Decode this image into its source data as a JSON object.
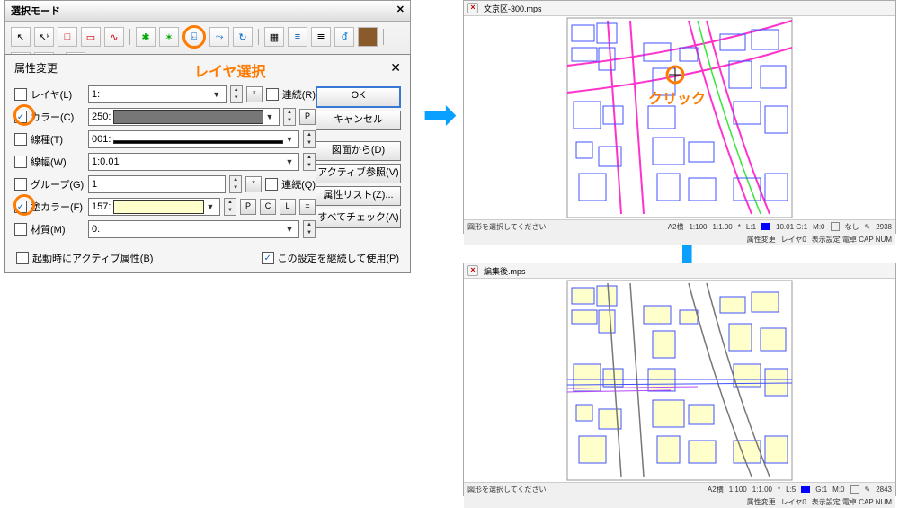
{
  "toolbar": {
    "title": "選択モード",
    "close": "✕"
  },
  "annotations": {
    "layer_select": "レイヤ選択",
    "click": "クリック"
  },
  "dialog": {
    "title": "属性変更",
    "close": "✕",
    "rows": {
      "layer": {
        "label": "レイヤ(L)",
        "value": "1:",
        "checked": false
      },
      "color": {
        "label": "カラー(C)",
        "value": "250:",
        "checked": true
      },
      "linetype": {
        "label": "線種(T)",
        "value": "001:",
        "checked": false
      },
      "linewid": {
        "label": "線幅(W)",
        "value": "1:0.01",
        "checked": false
      },
      "group": {
        "label": "グループ(G)",
        "value": "1",
        "checked": false
      },
      "fill": {
        "label": "塗カラー(F)",
        "value": "157:",
        "checked": true
      },
      "material": {
        "label": "材質(M)",
        "value": "0:",
        "checked": false
      }
    },
    "mini": {
      "star": "*",
      "p": "P",
      "c": "C",
      "l": "L",
      "eq": "="
    },
    "cont_r": "連続(R)",
    "cont_q": "連続(Q)",
    "buttons": {
      "ok": "OK",
      "cancel": "キャンセル",
      "from_drawing": "図面から(D)",
      "active_ref": "アクティブ参照(V)",
      "attr_list": "属性リスト(Z)...",
      "check_all": "すべてチェック(A)"
    },
    "footer": {
      "startup": "起動時にアクティブ属性(B)",
      "persist": "この設定を継続して使用(P)"
    }
  },
  "map_before": {
    "tab": "文京区-300.mps",
    "status_left": "図形を選択してください",
    "a2": "A2横",
    "s1": "1:100",
    "s2": "1:1.00",
    "l": "L:1",
    "gi": "10.01 G:1",
    "m": "M:0",
    "none": "なし",
    "count": "2938",
    "mode": "属性変更",
    "layer": "レイヤ0",
    "disp": "表示設定 電卓 CAP NUM"
  },
  "map_after": {
    "tab": "編集後.mps",
    "status_left": "図形を選択してください",
    "a2": "A2横",
    "s1": "1:100",
    "s2": "1:1.00",
    "l": "L:5",
    "gi": "G:1",
    "m": "M:0",
    "count": "2843",
    "mode": "属性変更",
    "layer": "レイヤ0",
    "disp": "表示設定 電卓 CAP NUM"
  }
}
